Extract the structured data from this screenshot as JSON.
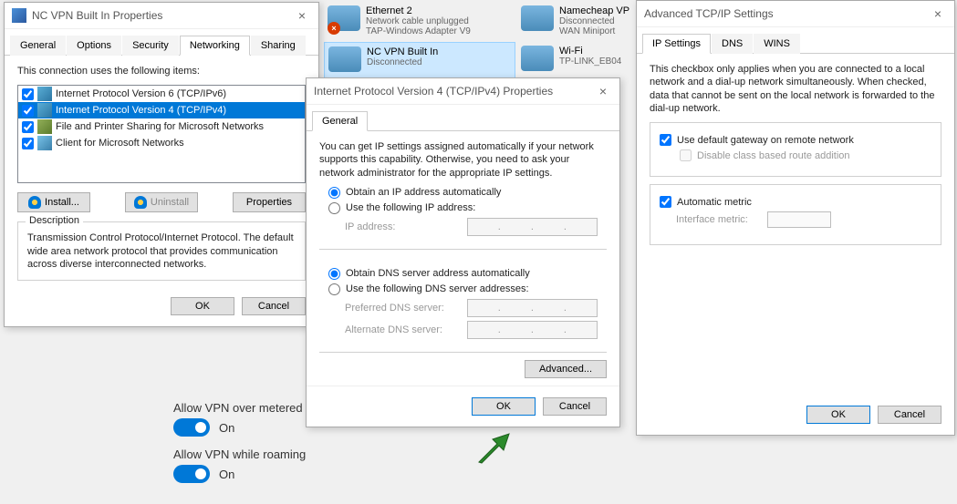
{
  "adapters": [
    {
      "name": "Ethernet 2",
      "line2": "Network cable unplugged",
      "line3": "TAP-Windows Adapter V9",
      "disc": true
    },
    {
      "name": "Namecheap VP",
      "line2": "Disconnected",
      "line3": "WAN Miniport"
    },
    {
      "name": "NC VPN Built In",
      "line2": "Disconnected",
      "line3": "",
      "selected": true
    },
    {
      "name": "Wi-Fi",
      "line2": "TP-LINK_EB04",
      "line3": ""
    }
  ],
  "settings": {
    "metered_label": "Allow VPN over metered n",
    "roaming_label": "Allow VPN while roaming",
    "on": "On"
  },
  "props": {
    "title": "NC VPN Built In Properties",
    "tabs": [
      "General",
      "Options",
      "Security",
      "Networking",
      "Sharing"
    ],
    "active_tab": "Networking",
    "list_label": "This connection uses the following items:",
    "items": [
      {
        "label": "Internet Protocol Version 6 (TCP/IPv6)",
        "icon": "protocol",
        "checked": true
      },
      {
        "label": "Internet Protocol Version 4 (TCP/IPv4)",
        "icon": "protocol",
        "checked": true,
        "selected": true
      },
      {
        "label": "File and Printer Sharing for Microsoft Networks",
        "icon": "printer",
        "checked": true
      },
      {
        "label": "Client for Microsoft Networks",
        "icon": "monitor",
        "checked": true
      }
    ],
    "btn_install": "Install...",
    "btn_uninstall": "Uninstall",
    "btn_properties": "Properties",
    "desc_label": "Description",
    "desc_text": "Transmission Control Protocol/Internet Protocol. The default wide area network protocol that provides communication across diverse interconnected networks.",
    "ok": "OK",
    "cancel": "Cancel"
  },
  "ipv4": {
    "title": "Internet Protocol Version 4 (TCP/IPv4) Properties",
    "tab": "General",
    "intro": "You can get IP settings assigned automatically if your network supports this capability. Otherwise, you need to ask your network administrator for the appropriate IP settings.",
    "obtain_ip": "Obtain an IP address automatically",
    "use_ip": "Use the following IP address:",
    "ip_label": "IP address:",
    "obtain_dns": "Obtain DNS server address automatically",
    "use_dns": "Use the following DNS server addresses:",
    "pref_dns": "Preferred DNS server:",
    "alt_dns": "Alternate DNS server:",
    "advanced": "Advanced...",
    "ok": "OK",
    "cancel": "Cancel"
  },
  "adv": {
    "title": "Advanced TCP/IP Settings",
    "tabs": [
      "IP Settings",
      "DNS",
      "WINS"
    ],
    "intro": "This checkbox only applies when you are connected to a local network and a dial-up network simultaneously.  When checked, data that cannot be sent on the local network is forwarded to the dial-up network.",
    "use_gateway": "Use default gateway on remote network",
    "disable_class": "Disable class based route addition",
    "auto_metric": "Automatic metric",
    "iface_metric": "Interface metric:",
    "ok": "OK",
    "cancel": "Cancel"
  }
}
